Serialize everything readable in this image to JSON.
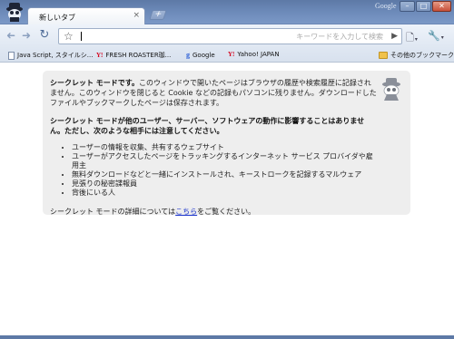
{
  "window": {
    "brand_label": "Google",
    "min_label": "–",
    "max_label": "□",
    "close_label": "✕"
  },
  "tab": {
    "title": "新しいタブ",
    "close_label": "×",
    "new_tab_label": "+"
  },
  "toolbar": {
    "back_label": "➜",
    "forward_label": "➜",
    "reload_label": "↻",
    "star_label": "☆",
    "omnibox_placeholder": "キーワードを入力して検索",
    "go_label": "▶",
    "page_menu_label": "🗋",
    "wrench_menu_label": "🔧",
    "dropdown_label": "▾"
  },
  "bookmarks": {
    "items": [
      {
        "label": "Java Script, スタイルシ...",
        "icon": "page-icon"
      },
      {
        "label": "FRESH ROASTER珈...",
        "icon": "yahoo-icon"
      },
      {
        "label": "Google",
        "icon": "google-icon"
      },
      {
        "label": "Yahoo! JAPAN",
        "icon": "yahoo-icon"
      }
    ],
    "other_label": "その他のブックマーク",
    "yahoo_glyph": "Y!",
    "google_glyph": "g"
  },
  "incognito": {
    "intro_bold": "シークレット モードです。",
    "intro_text": "このウィンドウで開いたページはブラウザの履歴や検索履歴に記録されません。このウィンドウを閉じると Cookie などの記録もパソコンに残りません。ダウンロードしたファイルやブックマークしたページは保存されます。",
    "warning": "シークレット モードが他のユーザー、サーバー、ソフトウェアの動作に影響することはありません。ただし、次のような相手には注意してください。",
    "list": [
      "ユーザーの情報を収集、共有するウェブサイト",
      "ユーザーがアクセスしたページをトラッキングするインターネット サービス プロバイダや雇用主",
      "無料ダウンロードなどと一緒にインストールされ、キーストロークを記録するマルウェア",
      "見張りの秘密諜報員",
      "背後にいる人"
    ],
    "footer_prefix": "シークレット モードの詳細については",
    "footer_link": "こちら",
    "footer_suffix": "をご覧ください。"
  },
  "colors": {
    "frame": "#6e8cbb",
    "toolbar": "#e6edf6",
    "box_bg": "#eeeeee",
    "link": "#1a33cc"
  }
}
